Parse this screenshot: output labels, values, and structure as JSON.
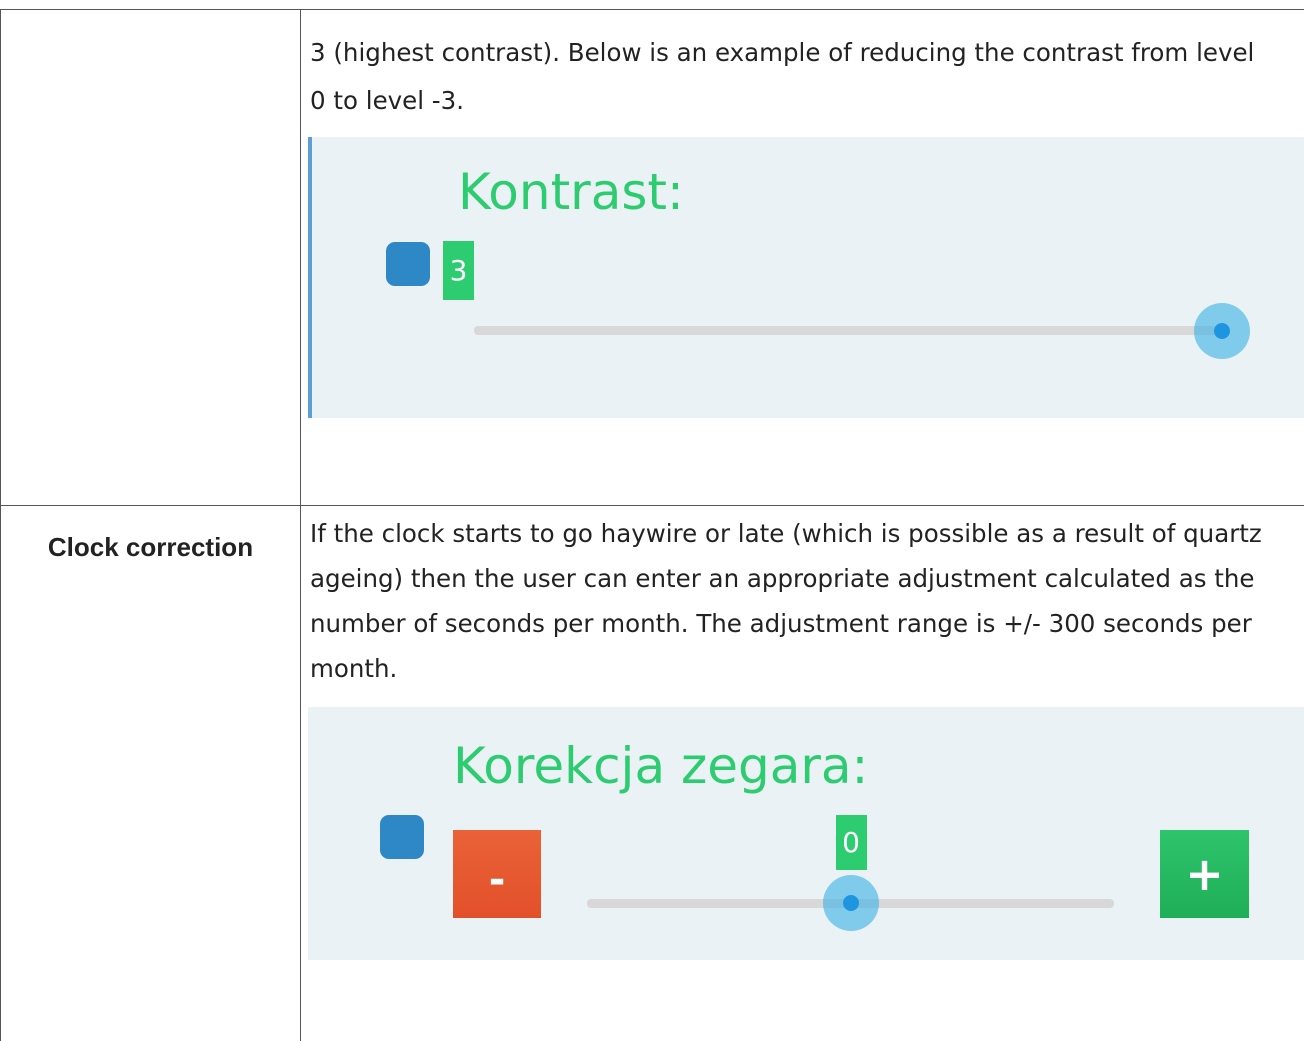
{
  "row1": {
    "label": "",
    "paragraph_lines": [
      "3 (highest contrast). Below is an example of reducing the contrast from level",
      "0 to level -3."
    ],
    "panel": {
      "title": "Kontrast:",
      "value": "3",
      "slider_fraction": 1.0,
      "accent_color": "#2ecc71"
    }
  },
  "row2": {
    "label": "Clock correction",
    "paragraph_lines": [
      "If the clock starts to go haywire or late (which is possible as a result of quartz",
      "ageing) then the user can enter an appropriate adjustment calculated as the",
      "number of seconds per month. The adjustment range is +/- 300 seconds per",
      "month."
    ],
    "panel": {
      "title": "Korekcja zegara:",
      "value": "0",
      "minus_label": "-",
      "plus_label": "+",
      "slider_fraction": 0.5,
      "minus_color": "#e55a2b",
      "plus_color": "#27b862"
    }
  }
}
